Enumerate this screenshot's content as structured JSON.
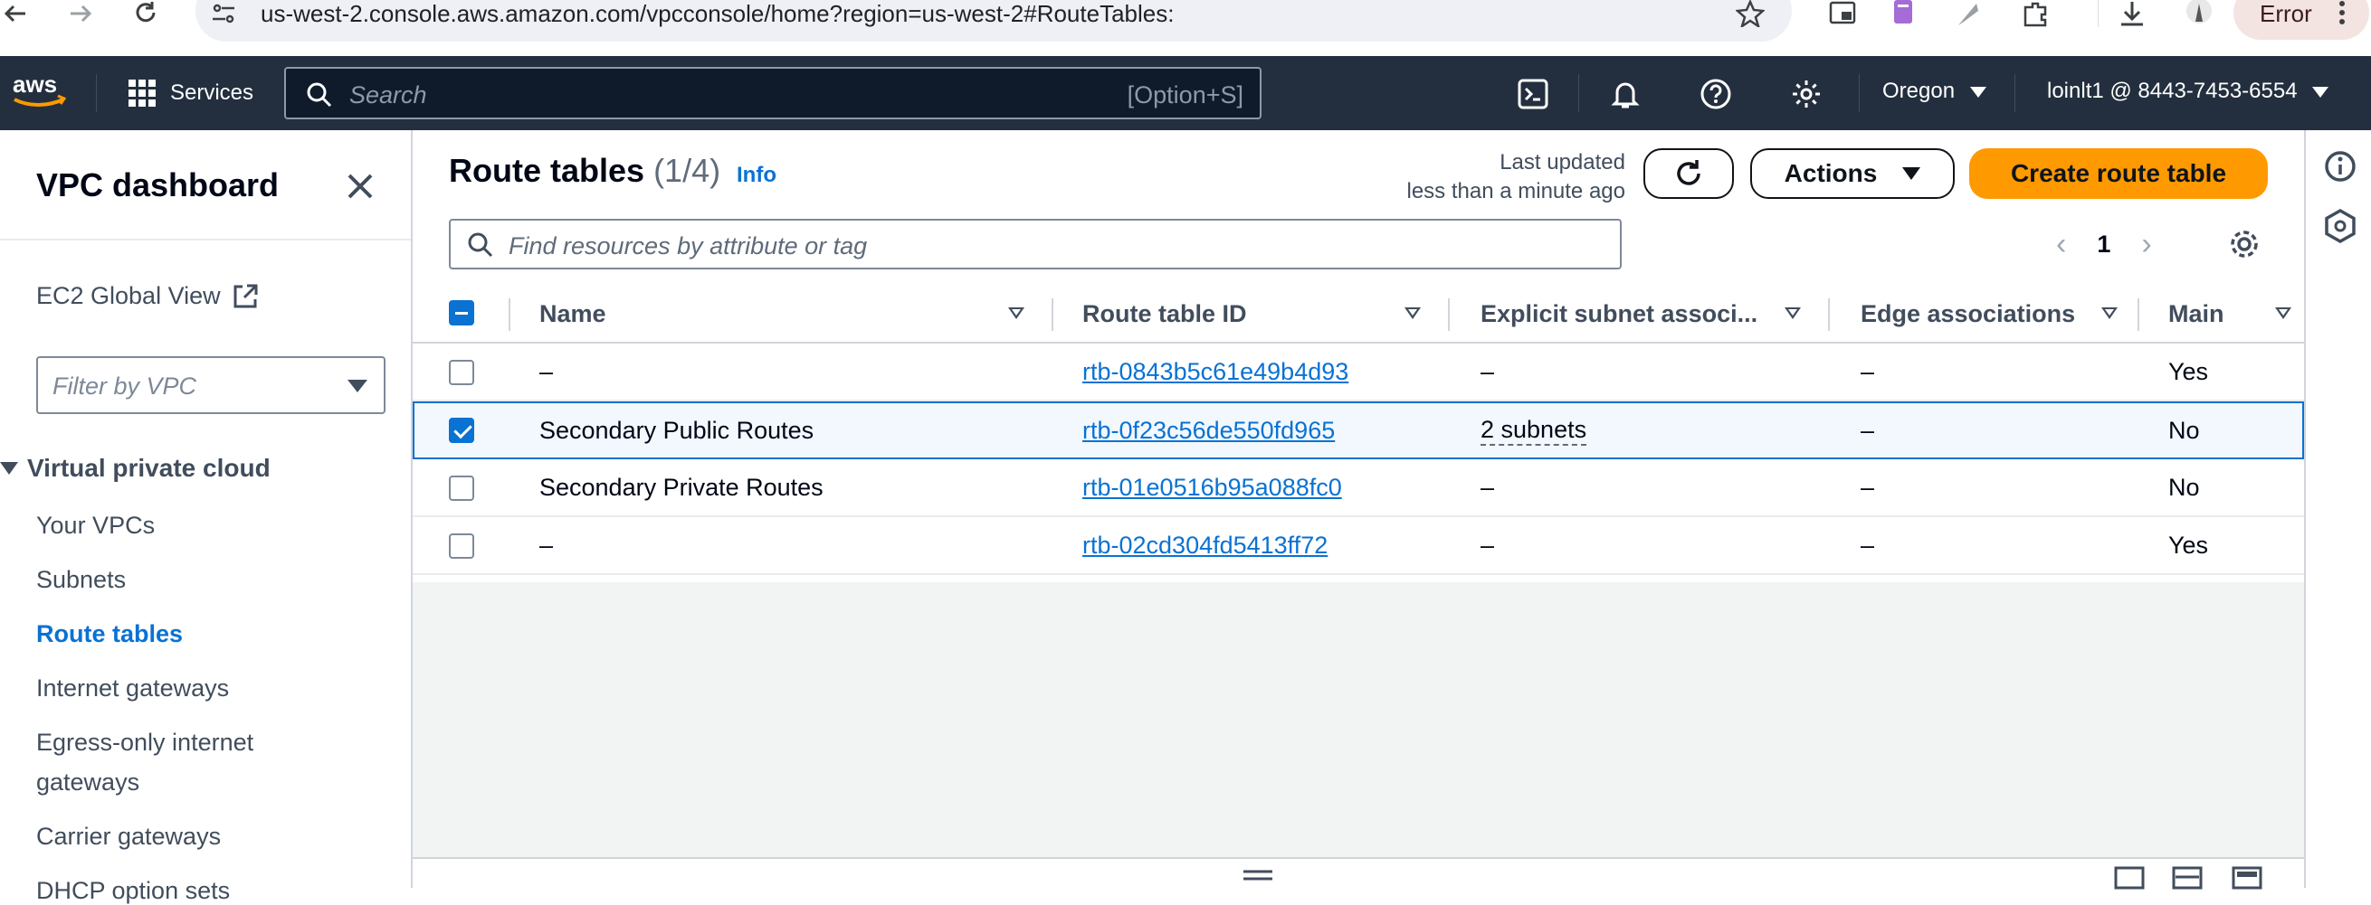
{
  "browser": {
    "url": "us-west-2.console.aws.amazon.com/vpcconsole/home?region=us-west-2#RouteTables:",
    "error_label": "Error"
  },
  "header": {
    "services_label": "Services",
    "search_placeholder": "Search",
    "search_shortcut": "[Option+S]",
    "region": "Oregon",
    "account": "loinlt1 @ 8443-7453-6554"
  },
  "sidebar": {
    "title": "VPC dashboard",
    "global_view": "EC2 Global View",
    "filter_placeholder": "Filter by VPC",
    "section_title": "Virtual private cloud",
    "items": [
      {
        "label": "Your VPCs"
      },
      {
        "label": "Subnets"
      },
      {
        "label": "Route tables"
      },
      {
        "label": "Internet gateways"
      },
      {
        "label": "Egress-only internet"
      },
      {
        "label": "gateways"
      },
      {
        "label": "Carrier gateways"
      },
      {
        "label": "DHCP option sets"
      }
    ]
  },
  "main": {
    "title": "Route tables",
    "count": "(1/4)",
    "info": "Info",
    "last_updated_label": "Last updated",
    "last_updated_value": "less than a minute ago",
    "actions_label": "Actions",
    "create_label": "Create route table",
    "filter_placeholder": "Find resources by attribute or tag",
    "page": "1",
    "columns": [
      "Name",
      "Route table ID",
      "Explicit subnet associ...",
      "Edge associations",
      "Main"
    ],
    "rows": [
      {
        "name": "–",
        "id": "rtb-0843b5c61e49b4d93",
        "subnets": "–",
        "edge": "–",
        "main": "Yes",
        "selected": false
      },
      {
        "name": "Secondary Public Routes",
        "id": "rtb-0f23c56de550fd965",
        "subnets": "2 subnets",
        "edge": "–",
        "main": "No",
        "selected": true
      },
      {
        "name": "Secondary Private Routes",
        "id": "rtb-01e0516b95a088fc0",
        "subnets": "–",
        "edge": "–",
        "main": "No",
        "selected": false
      },
      {
        "name": "–",
        "id": "rtb-02cd304fd5413ff72",
        "subnets": "–",
        "edge": "–",
        "main": "Yes",
        "selected": false
      }
    ]
  },
  "colors": {
    "aws_header": "#232f3e",
    "link": "#0972d3",
    "primary_button": "#ff9900"
  }
}
